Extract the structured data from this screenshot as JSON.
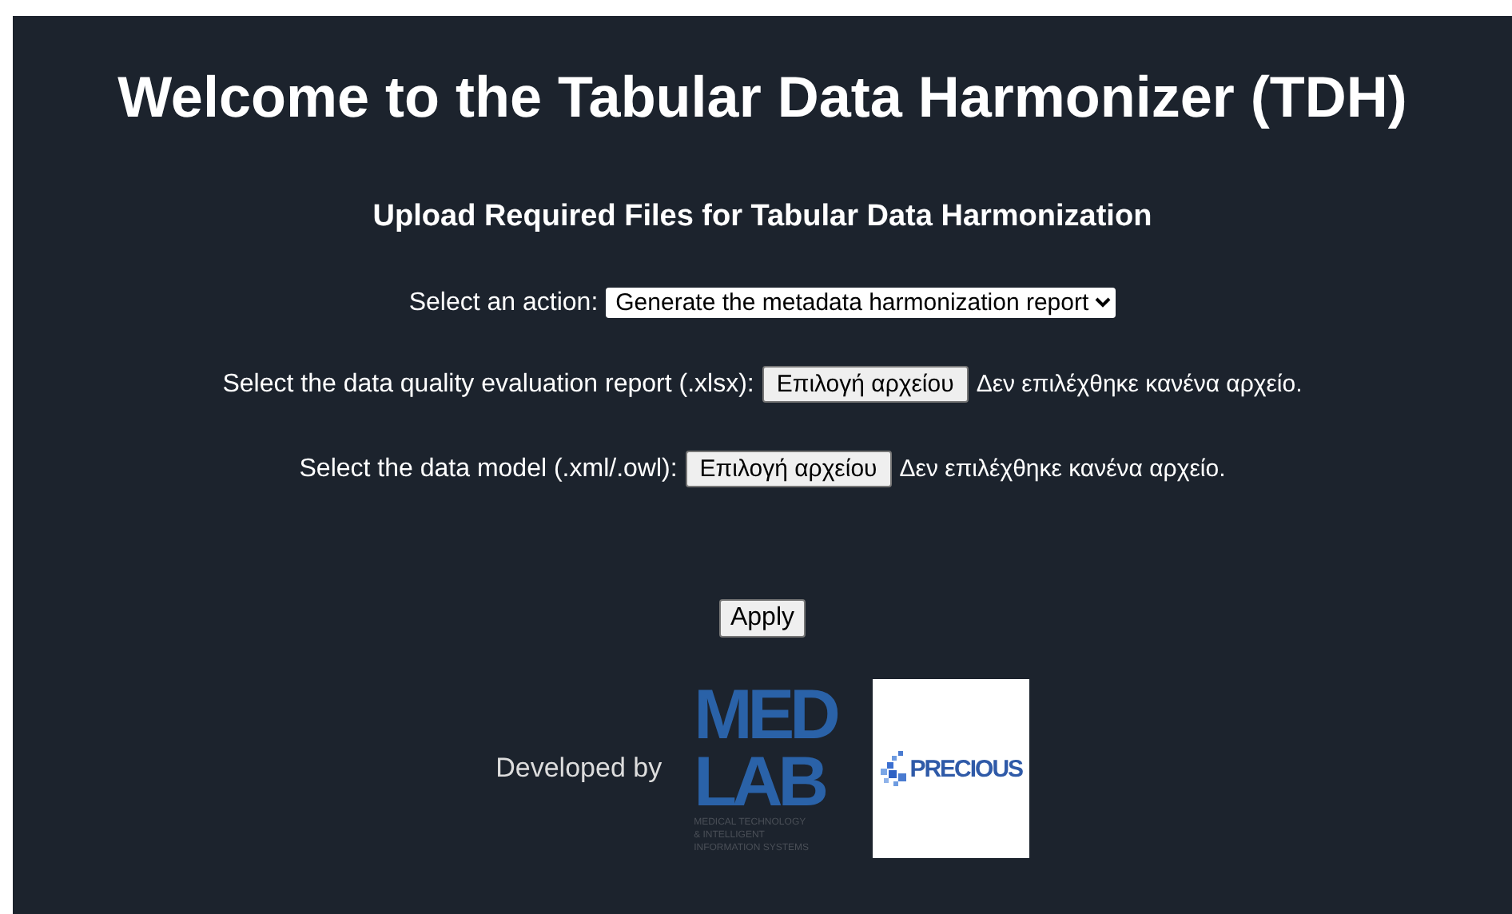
{
  "title": "Welcome to the Tabular Data Harmonizer (TDH)",
  "subtitle": "Upload Required Files for Tabular Data Harmonization",
  "action": {
    "label": "Select an action:",
    "value": "Generate the metadata harmonization report"
  },
  "file_inputs": [
    {
      "label": "Select the data quality evaluation report (.xlsx):",
      "button": "Επιλογή αρχείου",
      "status": "Δεν επιλέχθηκε κανένα αρχείο."
    },
    {
      "label": "Select the data model (.xml/.owl):",
      "button": "Επιλογή αρχείου",
      "status": "Δεν επιλέχθηκε κανένα αρχείο."
    }
  ],
  "apply_button": "Apply",
  "footer": {
    "label": "Developed by",
    "medlab_logo": {
      "lines": [
        "MED",
        "LAB"
      ],
      "tagline": [
        "MEDICAL TECHNOLOGY",
        "& INTELLIGENT",
        "INFORMATION SYSTEMS"
      ]
    },
    "precious_logo": {
      "text": "PRECIOUS"
    }
  }
}
